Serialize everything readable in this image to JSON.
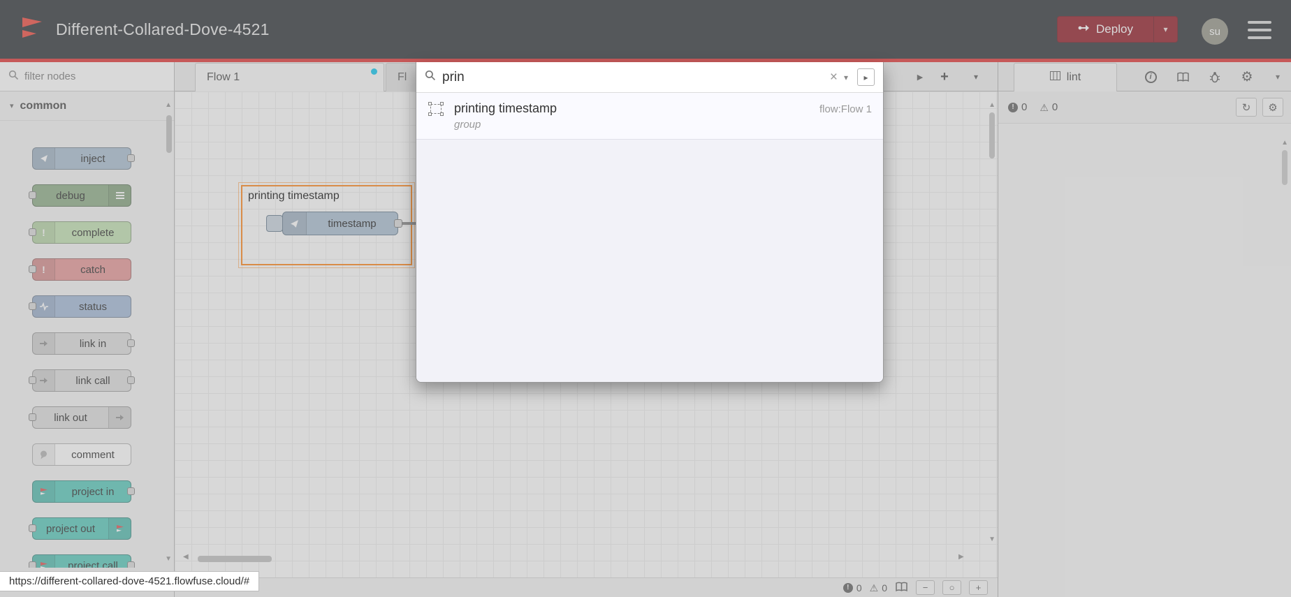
{
  "app": {
    "title": "Different-Collared-Dove-4521"
  },
  "header": {
    "deploy_label": "Deploy",
    "avatar": "su"
  },
  "palette": {
    "filter_placeholder": "filter nodes",
    "category_label": "common",
    "nodes": [
      {
        "label": "inject"
      },
      {
        "label": "debug"
      },
      {
        "label": "complete"
      },
      {
        "label": "catch"
      },
      {
        "label": "status"
      },
      {
        "label": "link in"
      },
      {
        "label": "link call"
      },
      {
        "label": "link out"
      },
      {
        "label": "comment"
      },
      {
        "label": "project in"
      },
      {
        "label": "project out"
      },
      {
        "label": "project call"
      }
    ]
  },
  "tabs": {
    "active_label": "Flow 1",
    "partial_label": "Fl"
  },
  "canvas": {
    "group_label": "printing timestamp",
    "node_label": "timestamp",
    "error_count": "0",
    "warning_count": "0"
  },
  "search": {
    "query": "prin",
    "result": {
      "title": "printing timestamp",
      "subtitle": "group",
      "location": "flow:Flow 1"
    }
  },
  "sidebar": {
    "tab_label": "lint",
    "error_count": "0",
    "warning_count": "0"
  },
  "browser": {
    "status_url": "https://different-collared-dove-4521.flowfuse.cloud/#"
  },
  "icons": {
    "chevron_down": "▾",
    "triangle_right": "▶",
    "triangle_left": "◀",
    "triangle_up": "▲",
    "triangle_down": "▼",
    "caret_right": "▸",
    "plus": "+",
    "minus": "−",
    "circle": "○",
    "close": "×",
    "gear": "⚙",
    "refresh": "↻",
    "warning": "⚠",
    "exclam": "!",
    "info": "i"
  },
  "colors": {
    "header_bg": "#23282e",
    "accent_red": "#e02b2b",
    "deploy_bg": "#8C101C",
    "tab_modified_dot": "#00c3ee",
    "group_selection": "#ff7f0e",
    "node_inject": "#a6bbcf",
    "node_debug": "#87a980",
    "node_complete": "#bfe0ae",
    "node_catch": "#e49191",
    "node_status": "#9fb6d5",
    "node_link": "#dddddd",
    "node_comment": "#ffffff",
    "node_project": "#4fc6b8"
  }
}
